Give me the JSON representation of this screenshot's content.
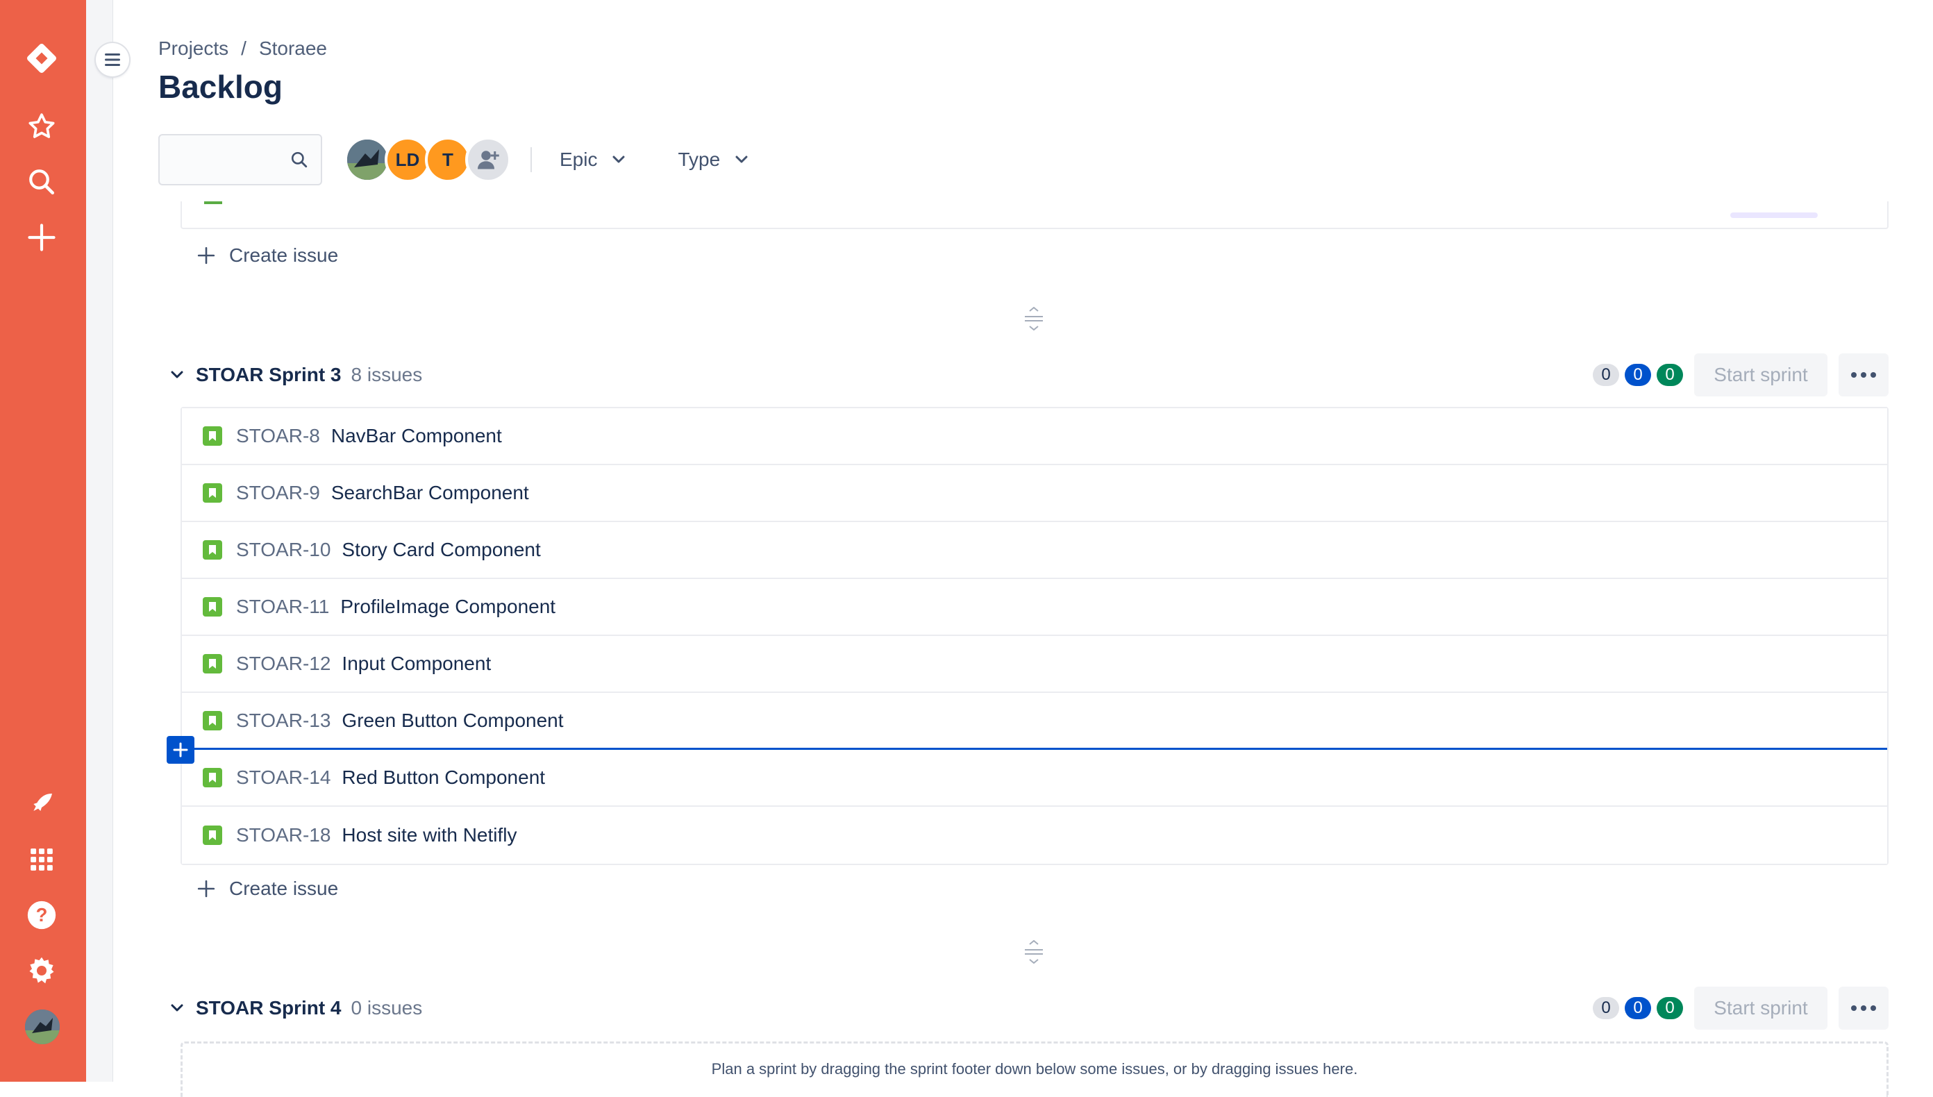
{
  "global_nav": {
    "icons": [
      "jira-logo-icon",
      "star-icon",
      "search-icon",
      "plus-icon",
      "rocket-icon",
      "app-grid-icon",
      "help-icon",
      "settings-icon",
      "user-avatar"
    ]
  },
  "header": {
    "breadcrumb": [
      "Projects",
      "/",
      "Storaee"
    ],
    "title": "Backlog"
  },
  "toolbar": {
    "search_placeholder": "",
    "avatars": [
      {
        "initials": "",
        "color": "#5e6f80"
      },
      {
        "initials": "LD",
        "color": "#ff991f"
      },
      {
        "initials": "T",
        "color": "#ff991f"
      },
      {
        "initials": "",
        "color": "#dfe1e6"
      }
    ],
    "filters": [
      "Epic",
      "Type"
    ]
  },
  "previous_section": {
    "create_issue_label": "Create issue"
  },
  "sprints": [
    {
      "name": "STOAR Sprint 3",
      "count_label": "8 issues",
      "badges": {
        "todo": "0",
        "in_progress": "0",
        "done": "0"
      },
      "start_label": "Start sprint",
      "issues": [
        {
          "key": "STOAR-8",
          "summary": "NavBar Component"
        },
        {
          "key": "STOAR-9",
          "summary": "SearchBar Component"
        },
        {
          "key": "STOAR-10",
          "summary": "Story Card Component"
        },
        {
          "key": "STOAR-11",
          "summary": "ProfileImage Component"
        },
        {
          "key": "STOAR-12",
          "summary": "Input Component"
        },
        {
          "key": "STOAR-13",
          "summary": "Green Button Component"
        },
        {
          "key": "STOAR-14",
          "summary": "Red Button Component"
        },
        {
          "key": "STOAR-18",
          "summary": "Host site with Netifly"
        }
      ],
      "create_issue_label": "Create issue"
    },
    {
      "name": "STOAR Sprint 4",
      "count_label": "0 issues",
      "badges": {
        "todo": "0",
        "in_progress": "0",
        "done": "0"
      },
      "start_label": "Start sprint",
      "empty_message": "Plan a sprint by dragging the sprint footer down below some issues, or by dragging issues here."
    }
  ],
  "colors": {
    "nav_bg": "#ed6148",
    "story_green": "#63ba3c",
    "in_progress_blue": "#0052cc",
    "done_green": "#00875a"
  }
}
